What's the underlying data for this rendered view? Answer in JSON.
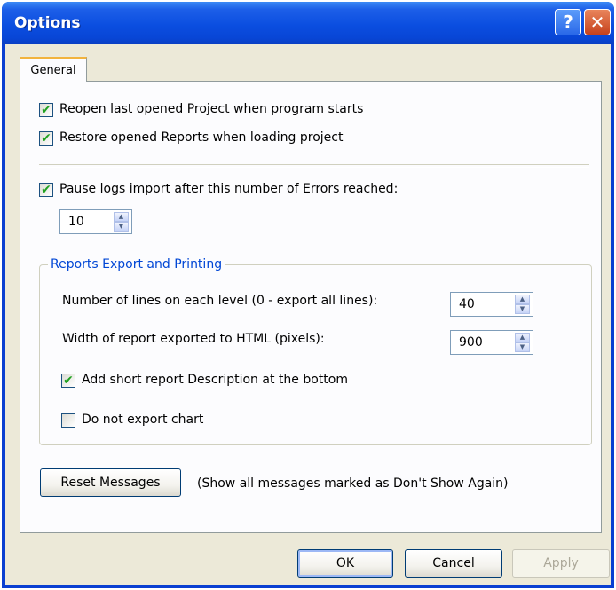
{
  "window": {
    "title": "Options",
    "help_label": "?",
    "close_label": "✕"
  },
  "tabs": [
    {
      "label": "General",
      "selected": true
    }
  ],
  "general": {
    "reopen_last_project": {
      "label": "Reopen last opened Project when program starts",
      "checked": true
    },
    "restore_reports": {
      "label": "Restore opened Reports when loading project",
      "checked": true
    },
    "pause_logs_import": {
      "label": "Pause logs import after this number of Errors reached:",
      "checked": true
    },
    "errors_limit": {
      "value": "10"
    }
  },
  "reports_export": {
    "group_title": "Reports Export and Printing",
    "lines_per_level": {
      "label": "Number of lines on each level (0 - export all lines):",
      "value": "40"
    },
    "html_width": {
      "label": "Width of report exported to HTML (pixels):",
      "value": "900"
    },
    "add_description": {
      "label": "Add short report Description at the bottom",
      "checked": true
    },
    "no_chart": {
      "label": "Do not export chart",
      "checked": false
    }
  },
  "messages": {
    "reset_label": "Reset Messages",
    "reset_hint": "(Show all messages marked as Don't Show Again)"
  },
  "footer": {
    "ok_label": "OK",
    "cancel_label": "Cancel",
    "apply_label": "Apply"
  },
  "icons": {
    "checkmark": "✔",
    "spin_up": "▲",
    "spin_down": "▼"
  }
}
